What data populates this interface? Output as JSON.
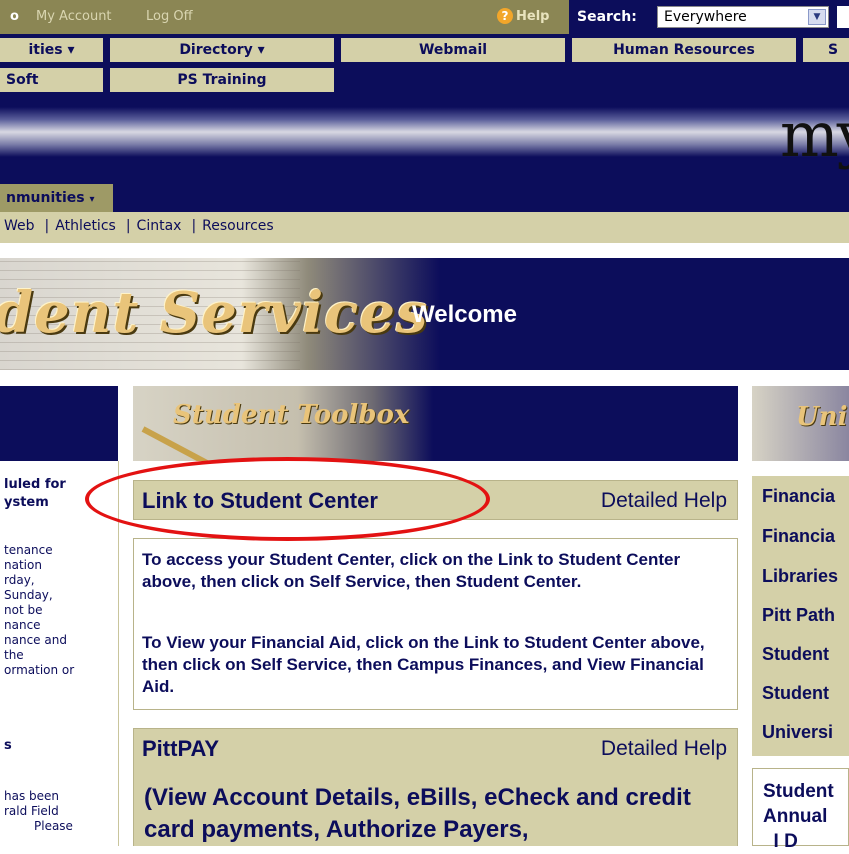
{
  "topbar": {
    "icon_glyph": "o",
    "my_account": "My Account",
    "log_off": "Log Off",
    "help": "Help",
    "search_label": "Search:",
    "search_scope": "Everywhere"
  },
  "nav": {
    "row1": [
      "ities ▾",
      "Directory ▾",
      "Webmail",
      "Human Resources",
      "S"
    ],
    "row2": [
      "Soft",
      "PS Training"
    ]
  },
  "logo_text": "my",
  "communities": {
    "label": "nmunities",
    "dropdown": "▾"
  },
  "link_bar": {
    "items": [
      "Web",
      "Athletics",
      "Cintax",
      "Resources"
    ],
    "separator": "|"
  },
  "banner": {
    "title": "dent Services",
    "welcome": "Welcome"
  },
  "left_column": {
    "heading1": [
      "luled for",
      "ystem"
    ],
    "body1": [
      "tenance",
      "nation",
      "rday,",
      "Sunday,",
      "not be",
      "nance",
      "nance and",
      "the",
      "ormation or"
    ],
    "heading2": "s",
    "body2": [
      "has been",
      "rald Field",
      "Please"
    ]
  },
  "toolbox": {
    "title": "Student Toolbox"
  },
  "student_center": {
    "link": "Link to Student Center",
    "help": "Detailed Help",
    "para1": "To access your Student Center, click on the Link to Student Center above, then click on Self Service, then Student Center.",
    "para2": "To View your Financial Aid, click on the Link to Student Center above, then click on Self Service, then Campus Finances, and View Financial Aid."
  },
  "pittpay": {
    "title": "PittPAY",
    "help": "Detailed Help",
    "body": "(View Account Details, eBills, eCheck and credit card payments, Authorize Payers,"
  },
  "right_column": {
    "header": "Uni",
    "links": [
      "Financia",
      "Financia",
      "Libraries",
      "Pitt Path",
      "Student",
      "Student",
      "Universi"
    ],
    "box": "Student\nAnnual\n  I D"
  },
  "colors": {
    "navy": "#0c0d5b",
    "khaki": "#d4d0a8",
    "olive": "#8b8654",
    "highlight_oval": "#e31212"
  }
}
